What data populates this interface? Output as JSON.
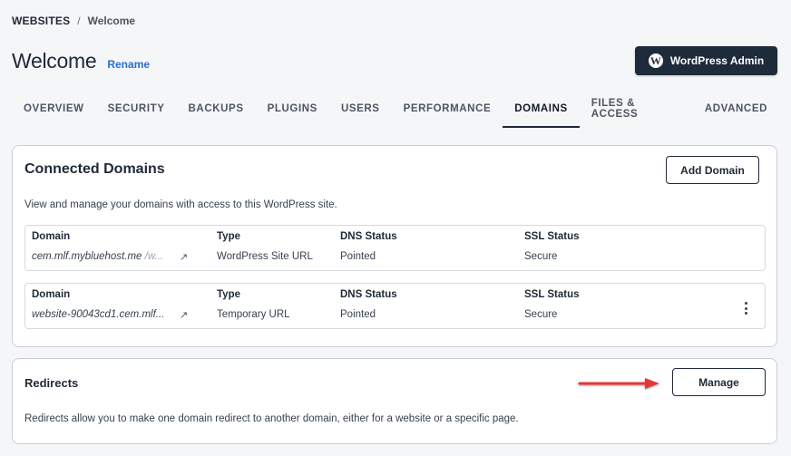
{
  "breadcrumb": {
    "root": "WEBSITES",
    "separator": "/",
    "current": "Welcome"
  },
  "header": {
    "title": "Welcome",
    "rename_label": "Rename",
    "wp_admin_label": "WordPress Admin",
    "wp_logo_glyph": "W"
  },
  "tabs": [
    {
      "label": "OVERVIEW"
    },
    {
      "label": "SECURITY"
    },
    {
      "label": "BACKUPS"
    },
    {
      "label": "PLUGINS"
    },
    {
      "label": "USERS"
    },
    {
      "label": "PERFORMANCE"
    },
    {
      "label": "DOMAINS",
      "active": true
    },
    {
      "label": "FILES & ACCESS"
    },
    {
      "label": "ADVANCED"
    }
  ],
  "connected_domains": {
    "title": "Connected Domains",
    "add_button": "Add Domain",
    "description": "View and manage your domains with access to this WordPress site.",
    "columns": [
      "Domain",
      "Type",
      "DNS Status",
      "SSL Status"
    ],
    "rows": [
      {
        "domain": "cem.mlf.mybluehost.me",
        "domain_suffix": "/w...",
        "type": "WordPress Site URL",
        "dns": "Pointed",
        "ssl": "Secure"
      },
      {
        "domain": "website-90043cd1.cem.mlf...",
        "domain_suffix": "",
        "type": "Temporary URL",
        "dns": "Pointed",
        "ssl": "Secure"
      }
    ],
    "external_link_glyph": "↗"
  },
  "redirects": {
    "title": "Redirects",
    "manage_button": "Manage",
    "description": "Redirects allow you to make one domain redirect to another domain, either for a website or a specific page."
  },
  "colors": {
    "accent_link": "#2b6cd4",
    "dark_button": "#1e2b3a",
    "annotation_arrow": "#e53935"
  }
}
